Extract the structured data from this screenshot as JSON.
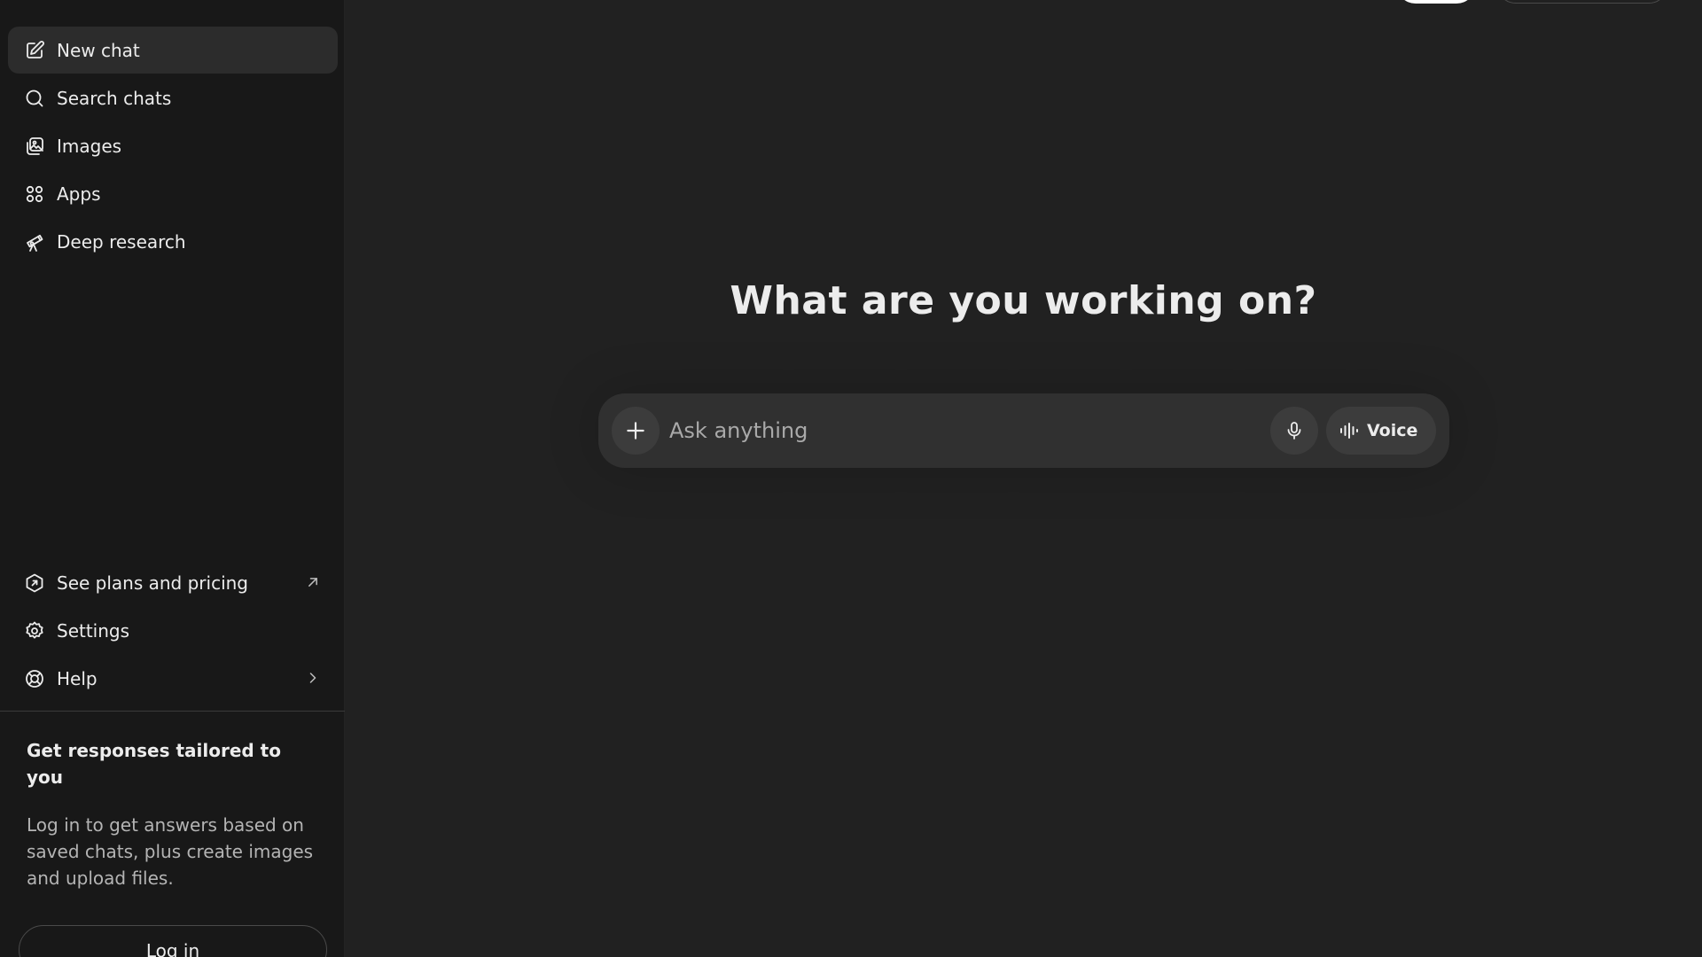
{
  "sidebar": {
    "items": [
      {
        "label": "New chat",
        "icon": "edit-icon"
      },
      {
        "label": "Search chats",
        "icon": "search-icon"
      },
      {
        "label": "Images",
        "icon": "images-icon"
      },
      {
        "label": "Apps",
        "icon": "apps-icon"
      },
      {
        "label": "Deep research",
        "icon": "telescope-icon"
      }
    ],
    "bottom_items": [
      {
        "label": "See plans and pricing",
        "icon": "plans-icon",
        "trail_icon": "external-arrow-icon"
      },
      {
        "label": "Settings",
        "icon": "gear-icon"
      },
      {
        "label": "Help",
        "icon": "lifebuoy-icon",
        "trail_icon": "chevron-right-icon"
      }
    ],
    "promo": {
      "title": "Get responses tailored to you",
      "body": "Log in to get answers based on saved chats, plus create images and upload files.",
      "login_label": "Log in"
    }
  },
  "main": {
    "headline": "What are you working on?",
    "composer": {
      "placeholder": "Ask anything",
      "voice_label": "Voice"
    }
  }
}
